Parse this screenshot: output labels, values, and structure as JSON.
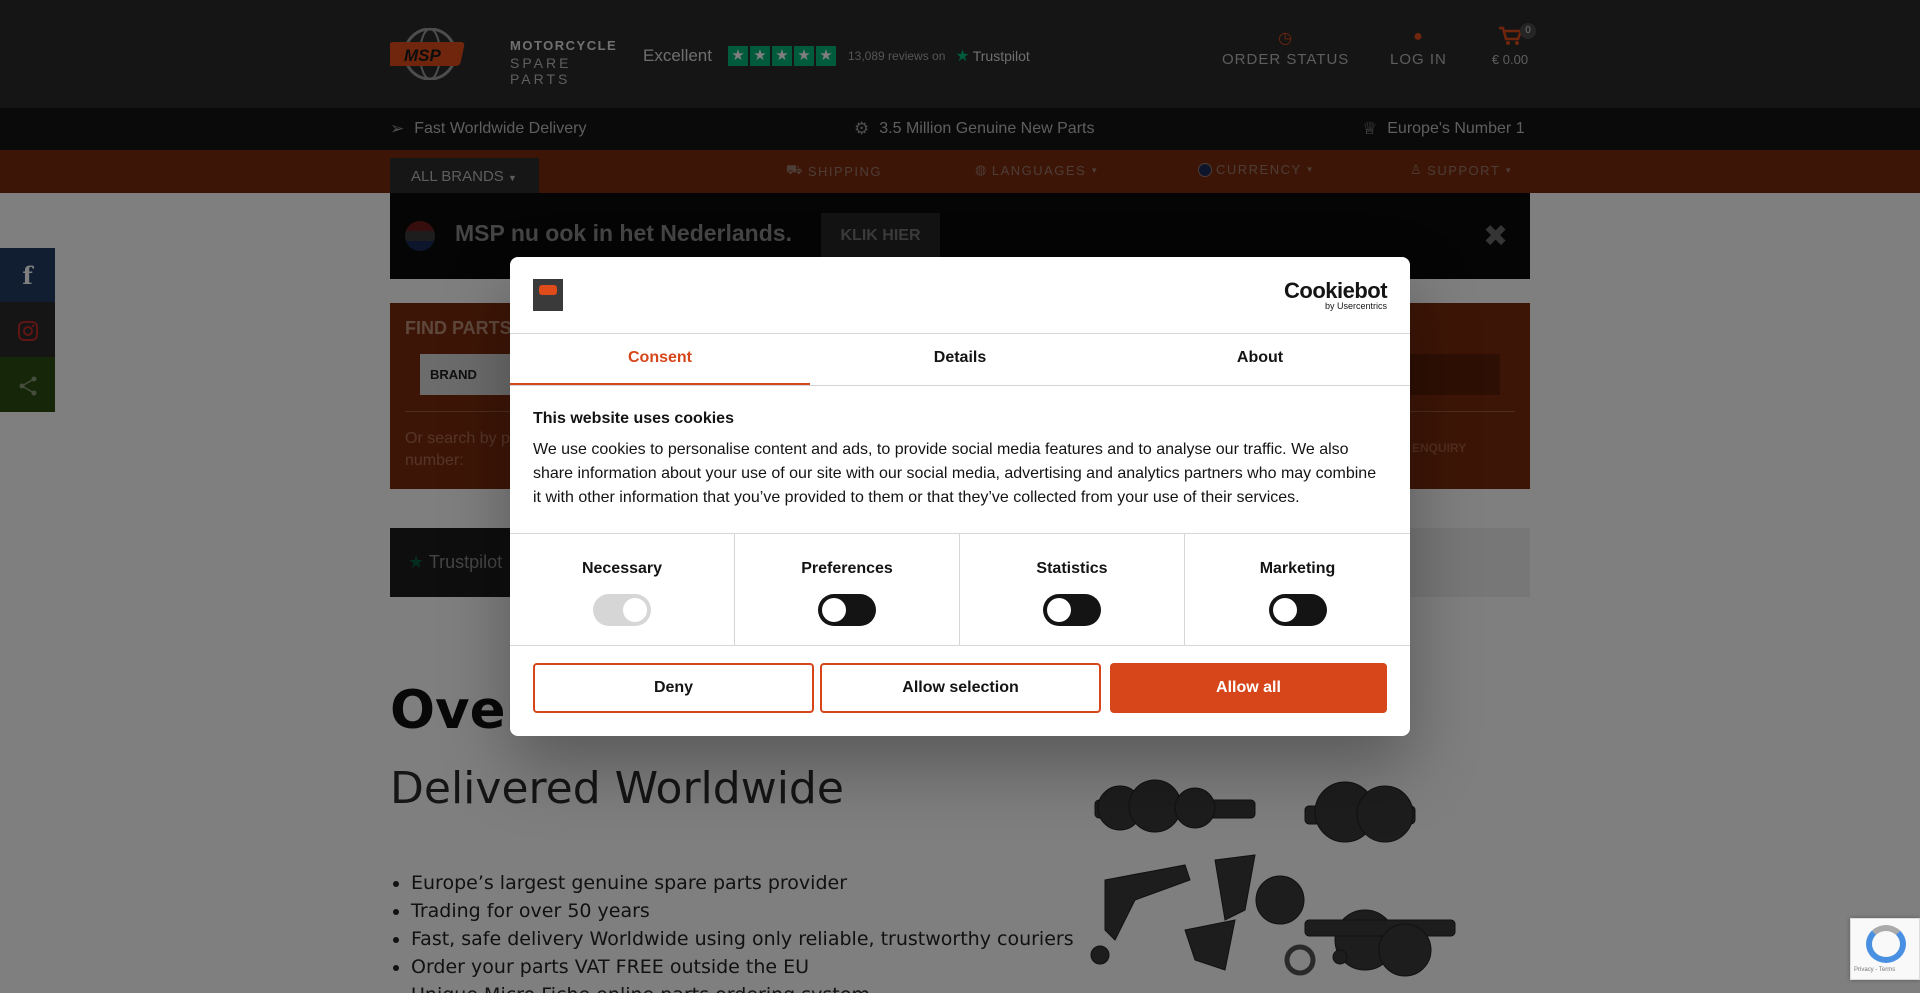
{
  "header": {
    "logo_line1": "MOTORCYCLE",
    "logo_line2": "SPARE PARTS",
    "logo_badge": "MSP",
    "trustpilot_rating_text": "Excellent",
    "trustpilot_reviews": "13,089 reviews on",
    "trustpilot_brand": "Trustpilot",
    "order_status": "ORDER STATUS",
    "log_in": "LOG IN",
    "cart_total": "€ 0.00",
    "cart_count": "0"
  },
  "features": {
    "delivery": "Fast Worldwide Delivery",
    "parts": "3.5 Million Genuine New Parts",
    "number1": "Europe's Number 1"
  },
  "nav": {
    "all_brands": "ALL BRANDS",
    "shipping": "SHIPPING",
    "languages": "LANGUAGES",
    "currency": "CURRENCY",
    "support": "SUPPORT"
  },
  "nl_banner": {
    "text": "MSP nu ook in het Nederlands.",
    "button": "KLIK HIER"
  },
  "find_parts": {
    "title": "FIND PARTS",
    "brand_select": "BRAND",
    "or_search": "Or search by p",
    "or_search_2": "number:",
    "enquiry": "ENQUIRY"
  },
  "trustpilot_strip": {
    "label": "Trustpilot"
  },
  "hero": {
    "heading": "Over",
    "subheading": "Delivered Worldwide",
    "bullets": [
      "Europe’s largest genuine spare parts provider",
      "Trading for over 50 years",
      "Fast, safe delivery Worldwide using only reliable, trustworthy couriers",
      "Order your parts VAT FREE outside the EU",
      "Unique Micro Fiche online parts ordering system"
    ]
  },
  "social": {
    "facebook": "f"
  },
  "recaptcha": {
    "text": "Privacy - Terms"
  },
  "cookie_dialog": {
    "provider": "Cookiebot",
    "provider_by": "by Usercentrics",
    "tabs": [
      "Consent",
      "Details",
      "About"
    ],
    "active_tab": "Consent",
    "heading": "This website uses cookies",
    "body": "We use cookies to personalise content and ads, to provide social media features and to analyse our traffic. We also share information about your use of our site with our social media, advertising and analytics partners who may combine it with other information that you’ve provided to them or that they’ve collected from your use of their services.",
    "categories": [
      {
        "label": "Necessary",
        "checked": true
      },
      {
        "label": "Preferences",
        "checked": false
      },
      {
        "label": "Statistics",
        "checked": false
      },
      {
        "label": "Marketing",
        "checked": false
      }
    ],
    "deny": "Deny",
    "allow_selection": "Allow selection",
    "allow_all": "Allow all"
  },
  "colors": {
    "accent": "#d6461a",
    "header_bg": "#2b2b2b",
    "nav_orange": "#c44a1a",
    "trustpilot_green": "#00b67a"
  },
  "icons": {
    "order_status": "clock-icon",
    "log_in": "user-icon",
    "cart": "cart-icon",
    "delivery": "paper-plane-icon",
    "parts": "gear-icon",
    "number1": "trophy-icon",
    "shipping": "truck-icon",
    "languages": "globe-icon",
    "currency": "coin-icon",
    "support": "support-icon",
    "close": "close-icon",
    "share": "share-icon",
    "instagram": "instagram-icon"
  }
}
